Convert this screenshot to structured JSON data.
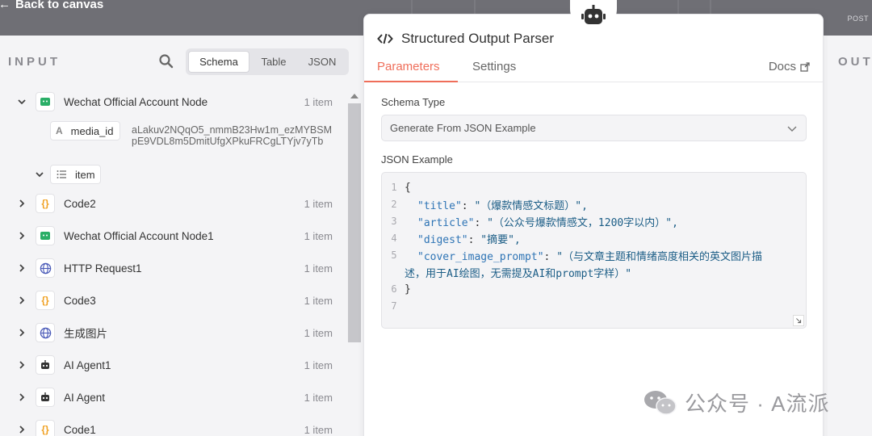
{
  "topbar": {
    "back_label": "Back to canvas",
    "post_label": "POST"
  },
  "input_panel": {
    "title": "INPUT",
    "view_tabs": [
      "Schema",
      "Table",
      "JSON"
    ],
    "active_view": "Schema",
    "media_field": {
      "label": "media_id",
      "value": "aLakuv2NQqO5_nmmB23Hw1m_ezMYBSMpE9VDL8m5DmitUfgXPkuFRCgLTYjv7yTb"
    },
    "item_field": {
      "label": "item"
    },
    "nodes": [
      {
        "label": "Wechat Official Account Node",
        "count": "1 item",
        "icon": "wechat-icon",
        "expanded": true
      },
      {
        "label": "Code2",
        "count": "1 item",
        "icon": "code-braces-icon"
      },
      {
        "label": "Wechat Official Account Node1",
        "count": "1 item",
        "icon": "wechat-icon"
      },
      {
        "label": "HTTP Request1",
        "count": "1 item",
        "icon": "globe-icon"
      },
      {
        "label": "Code3",
        "count": "1 item",
        "icon": "code-braces-icon"
      },
      {
        "label": "生成图片",
        "count": "1 item",
        "icon": "globe-icon"
      },
      {
        "label": "AI Agent1",
        "count": "1 item",
        "icon": "robot-icon"
      },
      {
        "label": "AI Agent",
        "count": "1 item",
        "icon": "robot-icon"
      },
      {
        "label": "Code1",
        "count": "1 item",
        "icon": "code-braces-icon"
      }
    ]
  },
  "output_panel": {
    "title": "OUT"
  },
  "parser_panel": {
    "title": "Structured Output Parser",
    "tabs": [
      "Parameters",
      "Settings"
    ],
    "active_tab": "Parameters",
    "docs_label": "Docs",
    "schema_type_label": "Schema Type",
    "schema_type_value": "Generate From JSON Example",
    "json_example_label": "JSON Example",
    "json_lines": [
      {
        "n": "1",
        "key": "",
        "value": "{"
      },
      {
        "n": "2",
        "key": "\"title\"",
        "value": "\"（爆款情感文标题）\","
      },
      {
        "n": "3",
        "key": "\"article\"",
        "value": "\"（公众号爆款情感文，1200字以内）\","
      },
      {
        "n": "4",
        "key": "\"digest\"",
        "value": "\"摘要\","
      },
      {
        "n": "5",
        "key": "\"cover_image_prompt\"",
        "value": "\"（与文章主题和情绪高度相关的英文图片描"
      },
      {
        "n": "",
        "key": "",
        "value": "述，用于AI绘图，无需提及AI和prompt字样）\""
      },
      {
        "n": "6",
        "key": "",
        "value": "}"
      },
      {
        "n": "7",
        "key": "",
        "value": ""
      }
    ]
  },
  "watermark": {
    "text": "公众号 · A流派"
  },
  "colors": {
    "accent": "#ef6e5a",
    "json_key": "#2e74b5",
    "wechat_green": "#2aae67"
  }
}
